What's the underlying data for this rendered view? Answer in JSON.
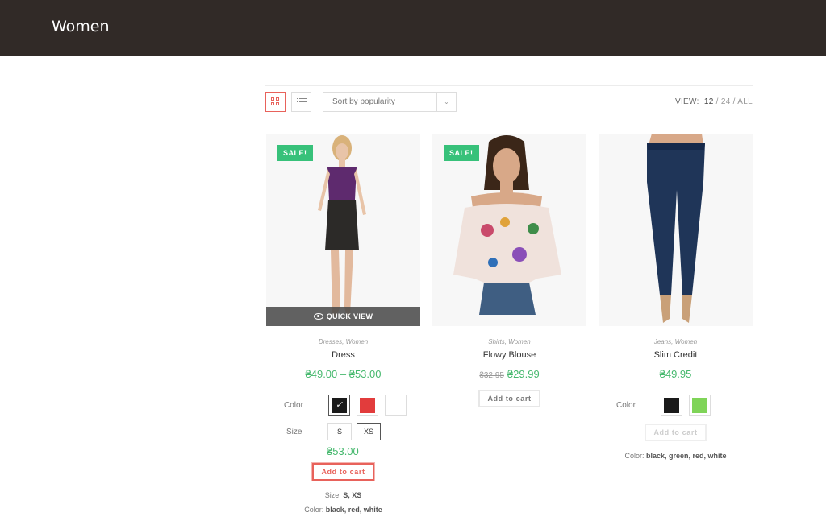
{
  "header": {
    "title": "Women"
  },
  "toolbar": {
    "sort_label": "Sort by popularity",
    "view_label": "VIEW:",
    "view_options": [
      "12",
      "24",
      "ALL"
    ],
    "separator": "/"
  },
  "products": [
    {
      "badge": "SALE!",
      "quick_view": "QUICK VIEW",
      "categories": "Dresses, Women",
      "name": "Dress",
      "price": "₴49.00 – ₴53.00",
      "color_label": "Color",
      "size_label": "Size",
      "swatches": [
        "#1a1a1a",
        "#e23c3c",
        "#ffffff"
      ],
      "sizes": [
        "S",
        "XS"
      ],
      "selected_price": "₴53.00",
      "add_to_cart": "Add to cart",
      "meta_size_label": "Size:",
      "meta_size_value": "S, XS",
      "meta_color_label": "Color:",
      "meta_color_value": "black, red, white"
    },
    {
      "badge": "SALE!",
      "categories": "Shirts, Women",
      "name": "Flowy Blouse",
      "old_price": "₴32.95",
      "price": "₴29.99",
      "add_to_cart": "Add to cart"
    },
    {
      "categories": "Jeans, Women",
      "name": "Slim Credit",
      "price": "₴49.95",
      "color_label": "Color",
      "swatches": [
        "#1a1a1a",
        "#7fd458"
      ],
      "add_to_cart": "Add to cart",
      "meta_color_label": "Color:",
      "meta_color_value": "black, green, red, white"
    }
  ],
  "colors": {
    "header_bg": "#312a27",
    "accent": "#e8625b",
    "sale": "#37c17a",
    "price": "#45b86d"
  }
}
